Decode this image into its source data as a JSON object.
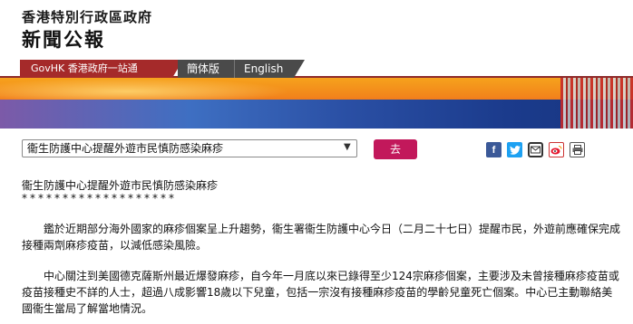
{
  "header": {
    "gov_title": "香港特別行政區政府",
    "press_title": "新聞公報"
  },
  "nav": {
    "govhk": "GovHK 香港政府一站通",
    "simplified": "簡体版",
    "english": "English"
  },
  "controls": {
    "select_value": "衞生防護中心提醒外遊市民慎防感染麻疹",
    "go_label": "去"
  },
  "share": {
    "icons": [
      "facebook-icon",
      "twitter-icon",
      "email-icon",
      "weibo-icon",
      "print-icon"
    ]
  },
  "article": {
    "title": "衞生防護中心提醒外遊市民慎防感染麻疹",
    "stars": "*******************",
    "para1": "鑑於近期部分海外國家的麻疹個案呈上升趨勢，衞生署衞生防護中心今日（二月二十七日）提醒市民，外遊前應確保完成接種兩劑麻疹疫苗，以減低感染風險。",
    "para2": "中心關注到美國德克薩斯州最近爆發麻疹，自今年一月底以來已錄得至少124宗麻疹個案，主要涉及未曾接種麻疹疫苗或疫苗接種史不詳的人士，超過八成影響18歲以下兒童，包括一宗沒有接種麻疹疫苗的學齡兒童死亡個案。中心已主動聯絡美國衞生當局了解當地情況。"
  },
  "colors": {
    "govhk_tab": "#a52a2a",
    "lang_tab": "#4a4a4a",
    "go_button": "#c2185b"
  }
}
